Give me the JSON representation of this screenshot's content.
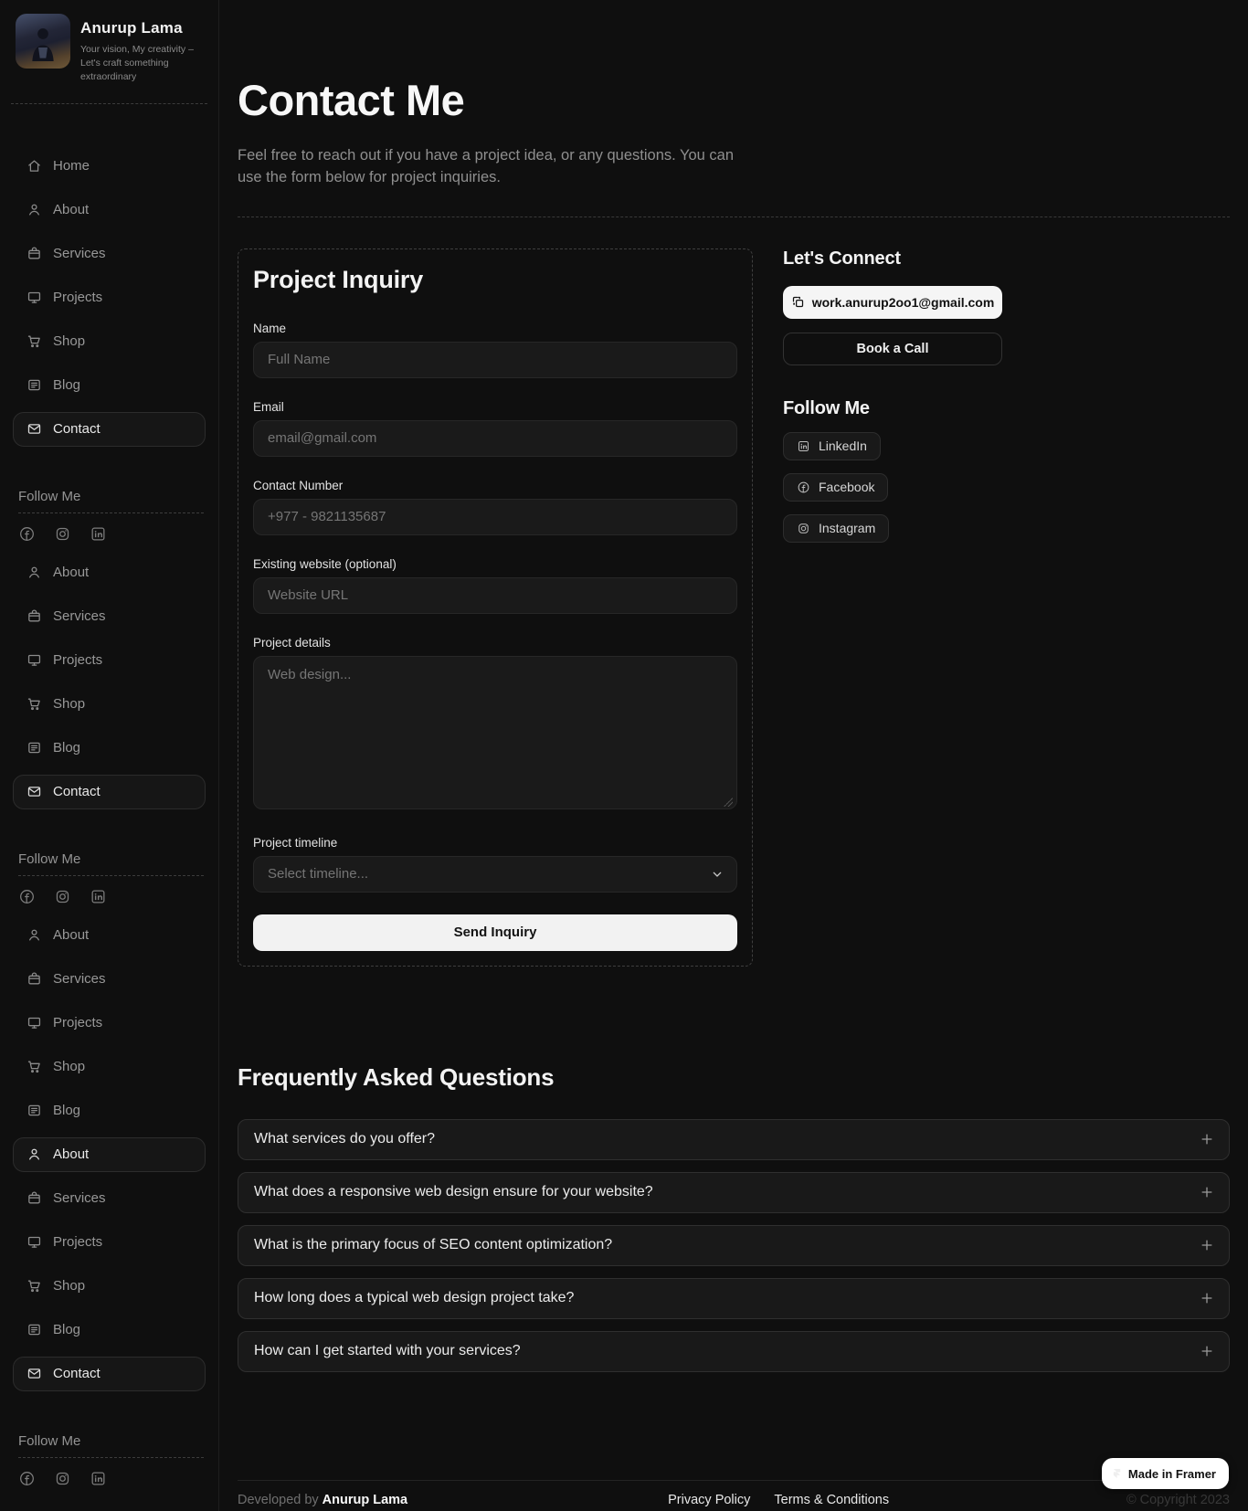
{
  "sidebar": {
    "profile": {
      "name": "Anurup Lama",
      "tagline": "Your vision, My creativity – Let's craft something extraordinary"
    },
    "nav": {
      "home": "Home",
      "about": "About",
      "services": "Services",
      "projects": "Projects",
      "shop": "Shop",
      "blog": "Blog",
      "contact": "Contact"
    },
    "follow_me_label": "Follow Me"
  },
  "header": {
    "title": "Contact Me",
    "subtitle": "Feel free to reach out if you have a project idea, or any questions. You can use the form below for project inquiries."
  },
  "form": {
    "title": "Project Inquiry",
    "name_label": "Name",
    "name_placeholder": "Full Name",
    "email_label": "Email",
    "email_placeholder": "email@gmail.com",
    "contact_label": "Contact Number",
    "contact_placeholder": "+977 - 9821135687",
    "website_label": "Existing website (optional)",
    "website_placeholder": "Website URL",
    "details_label": "Project details",
    "details_placeholder": "Web design...",
    "timeline_label": "Project timeline",
    "timeline_placeholder": "Select timeline...",
    "submit_label": "Send Inquiry"
  },
  "connect": {
    "title": "Let's Connect",
    "email_button_label": "work.anurup2oo1@gmail.com",
    "book_call_label": "Book a Call",
    "follow_title": "Follow Me",
    "linkedin_label": "LinkedIn",
    "facebook_label": "Facebook",
    "instagram_label": "Instagram"
  },
  "faq": {
    "title": "Frequently Asked Questions",
    "items": [
      {
        "question": "What services do you offer?"
      },
      {
        "question": "What does a responsive web design ensure for your website?"
      },
      {
        "question": "What is the primary focus of SEO content optimization?"
      },
      {
        "question": "How long does a typical web design project take?"
      },
      {
        "question": "How can I get started with your services?"
      }
    ]
  },
  "footer": {
    "developed_by": "Developed by",
    "author": "Anurup Lama",
    "privacy_label": "Privacy Policy",
    "terms_label": "Terms & Conditions",
    "copyright": "© Copyright 2023",
    "badge_label": "Made in Framer"
  },
  "colors": {
    "background": "#0f0f0f",
    "panel": "#191919",
    "accent_button": "#f5f5f5",
    "text_muted": "#8f8f8f"
  }
}
